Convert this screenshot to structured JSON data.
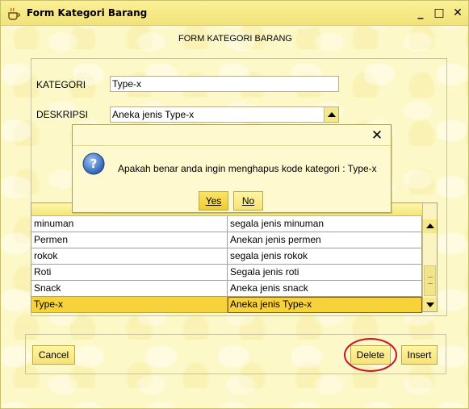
{
  "window": {
    "title": "Form Kategori Barang",
    "controls": {
      "minimize": "_",
      "maximize": "□",
      "close": "✕"
    }
  },
  "form": {
    "heading": "FORM KATEGORI BARANG",
    "kategori_label": "KATEGORI",
    "kategori_value": "Type-x",
    "deskripsi_label": "DESKRIPSI",
    "deskripsi_value": "Aneka jenis Type-x"
  },
  "table": {
    "rows": [
      {
        "kategori": "minuman",
        "deskripsi": "segala jenis minuman"
      },
      {
        "kategori": "Permen",
        "deskripsi": "Anekan jenis permen"
      },
      {
        "kategori": "rokok",
        "deskripsi": "segala jenis rokok"
      },
      {
        "kategori": "Roti",
        "deskripsi": "Segala jenis roti"
      },
      {
        "kategori": "Snack",
        "deskripsi": "Aneka jenis snack"
      },
      {
        "kategori": "Type-x",
        "deskripsi": "Aneka jenis Type-x"
      }
    ],
    "selected_index": 5
  },
  "buttons": {
    "cancel": "Cancel",
    "delete": "Delete",
    "insert": "Insert"
  },
  "dialog": {
    "message": "Apakah benar anda ingin menghapus kode kategori : Type-x",
    "yes_label": "Yes",
    "no_label": "No",
    "close": "✕"
  },
  "colors": {
    "window_bg": "#fdf8c8",
    "selection": "#f8d23a",
    "annotation": "#c8102e"
  }
}
